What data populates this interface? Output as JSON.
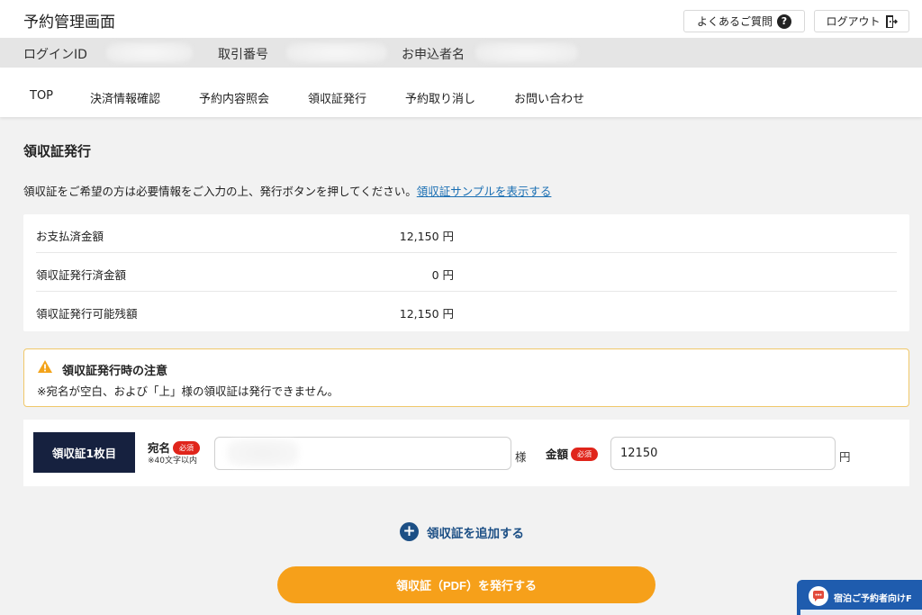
{
  "header": {
    "title": "予約管理画面",
    "faq_label": "よくあるご質問",
    "logout_label": "ログアウト"
  },
  "idbar": {
    "login_id_label": "ログインID",
    "transaction_label": "取引番号",
    "applicant_label": "お申込者名"
  },
  "nav": {
    "items": [
      "TOP",
      "決済情報確認",
      "予約内容照会",
      "領収証発行",
      "予約取り消し",
      "お問い合わせ"
    ]
  },
  "page": {
    "title": "領収証発行",
    "description": "領収証をご希望の方は必要情報をご入力の上、発行ボタンを押してください。",
    "sample_link": "領収証サンプルを表示する"
  },
  "amounts": {
    "rows": [
      {
        "label": "お支払済金額",
        "value": "12,150 円"
      },
      {
        "label": "領収証発行済金額",
        "value": "0 円"
      },
      {
        "label": "領収証発行可能残額",
        "value": "12,150 円"
      }
    ]
  },
  "notice": {
    "title": "領収証発行時の注意",
    "text": "※宛名が空白、および「上」様の領収証は発行できません。"
  },
  "receipt": {
    "badge": "領収証1枚目",
    "name_label": "宛名",
    "required": "必須",
    "name_note": "※40文字以内",
    "name_value": "",
    "name_suffix": "様",
    "amount_label": "金額",
    "amount_value": "12150",
    "amount_suffix": "円"
  },
  "actions": {
    "add_label": "領収証を追加する",
    "issue_label": "領収証（PDF）を発行する"
  },
  "chat": {
    "label": "宿泊ご予約者向けF"
  },
  "colors": {
    "navy": "#16213f",
    "accent_orange": "#f6a01a",
    "link_blue": "#1a6fb3",
    "required_red": "#e0251b",
    "warning_border": "#f0c86a"
  }
}
